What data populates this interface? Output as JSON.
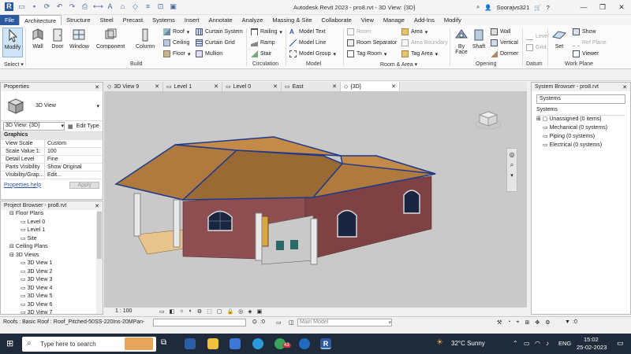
{
  "title_bar": {
    "title": "Autodesk Revit 2023 - pro8.rvt - 3D View: {3D}",
    "user": "Soorajvs321"
  },
  "ribbon_tabs": [
    "File",
    "Architecture",
    "Structure",
    "Steel",
    "Precast",
    "Systems",
    "Insert",
    "Annotate",
    "Analyze",
    "Massing & Site",
    "Collaborate",
    "View",
    "Manage",
    "Add-Ins",
    "Modify"
  ],
  "ribbon": {
    "modify": "Modify",
    "wall": "Wall",
    "door": "Door",
    "window": "Window",
    "component": "Component",
    "column": "Column",
    "roof": "Roof",
    "ceiling": "Ceiling",
    "floor": "Floor",
    "curtain_system": "Curtain System",
    "curtain_grid": "Curtain Grid",
    "mullion": "Mullion",
    "railing": "Railing",
    "ramp": "Ramp",
    "stair": "Stair",
    "model_text": "Model Text",
    "model_line": "Model Line",
    "model_group": "Model Group",
    "room": "Room",
    "room_separator": "Room Separator",
    "tag_room": "Tag Room",
    "area": "Area",
    "area_boundary": "Area Boundary",
    "tag_area": "Tag Area",
    "by_face": "By Face",
    "shaft": "Shaft",
    "wall_open": "Wall",
    "vertical": "Vertical",
    "dormer": "Dormer",
    "level": "Level",
    "grid": "Grid",
    "set": "Set",
    "show": "Show",
    "ref_plane": "Ref Plane",
    "viewer": "Viewer",
    "groups": {
      "select": "Select",
      "build": "Build",
      "circulation": "Circulation",
      "model": "Model",
      "room_area": "Room & Area",
      "opening": "Opening",
      "datum": "Datum",
      "work_plane": "Work Plane"
    }
  },
  "properties": {
    "header": "Properties",
    "type_name": "3D View",
    "selector": "3D View: {3D}",
    "edit_type": "Edit Type",
    "section": "Graphics",
    "rows": [
      {
        "k": "View Scale",
        "v": "Custom"
      },
      {
        "k": "Scale Value    1:",
        "v": "100"
      },
      {
        "k": "Detail Level",
        "v": "Fine"
      },
      {
        "k": "Parts Visibility",
        "v": "Show Original"
      },
      {
        "k": "Visibility/Grap...",
        "v": "Edit..."
      }
    ],
    "help": "Properties help",
    "apply": "Apply"
  },
  "project_browser": {
    "header": "Project Browser - pro8.rvt",
    "items": [
      {
        "label": "Floor Plans",
        "indent": 1,
        "kind": "folder"
      },
      {
        "label": "Level 0",
        "indent": 3,
        "kind": "view"
      },
      {
        "label": "Level 1",
        "indent": 3,
        "kind": "view"
      },
      {
        "label": "Site",
        "indent": 3,
        "kind": "view"
      },
      {
        "label": "Ceiling Plans",
        "indent": 1,
        "kind": "folder"
      },
      {
        "label": "3D Views",
        "indent": 1,
        "kind": "folder"
      },
      {
        "label": "3D View 1",
        "indent": 3,
        "kind": "view"
      },
      {
        "label": "3D View 2",
        "indent": 3,
        "kind": "view"
      },
      {
        "label": "3D View 3",
        "indent": 3,
        "kind": "view"
      },
      {
        "label": "3D View 4",
        "indent": 3,
        "kind": "view"
      },
      {
        "label": "3D View 5",
        "indent": 3,
        "kind": "view"
      },
      {
        "label": "3D View 6",
        "indent": 3,
        "kind": "view"
      },
      {
        "label": "3D View 7",
        "indent": 3,
        "kind": "view"
      }
    ]
  },
  "view_tabs": [
    "3D View 9",
    "Level 1",
    "Level 0",
    "East",
    "{3D}"
  ],
  "view_bar": {
    "scale": "1 : 100"
  },
  "system_browser": {
    "header": "System Browser - pro8.rvt",
    "filter": "Systems",
    "root": "Systems",
    "items": [
      "Unassigned (0 items)",
      "Mechanical (0 systems)",
      "Piping (0 systems)",
      "Electrical (0 systems)"
    ]
  },
  "status": {
    "text": "Roofs : Basic Roof : Roof_Pitched-50SS-220Ins-20MPan-",
    "workset": ":0",
    "model": "Main Model",
    "filter": ":0"
  },
  "taskbar": {
    "search": "Type here to search",
    "badge": "43",
    "weather": "32°C  Sunny",
    "lang": "ENG",
    "time": "15:02",
    "date": "25-02-2023"
  },
  "colors": {
    "roof": "#b07a3e",
    "wall": "#8e4f52",
    "accent": "#2c5aa0",
    "viewport": "#c9c9c9"
  }
}
